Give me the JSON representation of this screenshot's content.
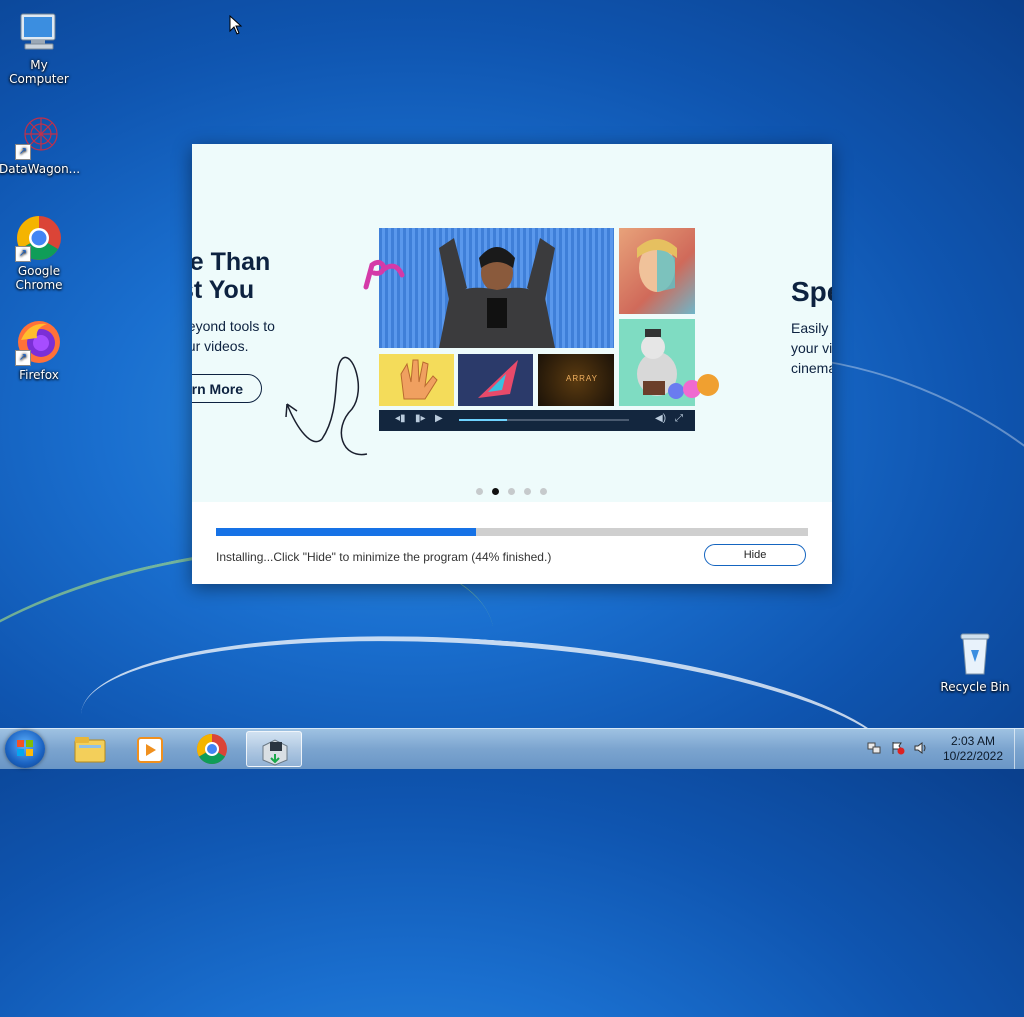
{
  "desktop": {
    "icons": [
      {
        "label": "My Computer",
        "icon": "computer-icon"
      },
      {
        "label": "DataWagon...",
        "icon": "datawagon-icon"
      },
      {
        "label": "Google Chrome",
        "icon": "chrome-icon"
      },
      {
        "label": "Firefox",
        "icon": "firefox-icon"
      },
      {
        "label": "Recycle Bin",
        "icon": "recycle-bin-icon"
      }
    ]
  },
  "installer": {
    "slides": {
      "left": {
        "heading_line1": "re Than",
        "heading_line2": "st You",
        "text_line1": "beyond tools to",
        "text_line2": "our videos.",
        "button": "rn More"
      },
      "right": {
        "heading": "Spe",
        "text_line1": "Easily",
        "text_line2": "your vi",
        "text_line3": "cinema"
      },
      "player_caption": "ARRAY",
      "dots_total": 5,
      "dots_active_index": 1
    },
    "progress_fraction": 0.44,
    "status": "Installing...Click \"Hide\" to minimize the program (44% finished.)",
    "hide_button": "Hide"
  },
  "taskbar": {
    "pinned": [
      "start-orb",
      "explorer-icon",
      "media-player-icon",
      "chrome-icon",
      "installer-icon"
    ],
    "active_item": "installer-icon",
    "clock": {
      "time": "2:03 AM",
      "date": "10/22/2022"
    }
  },
  "colors": {
    "accent": "#1672e6",
    "text_dark": "#0d2240",
    "desktop_blue": "#1a6fcf"
  }
}
